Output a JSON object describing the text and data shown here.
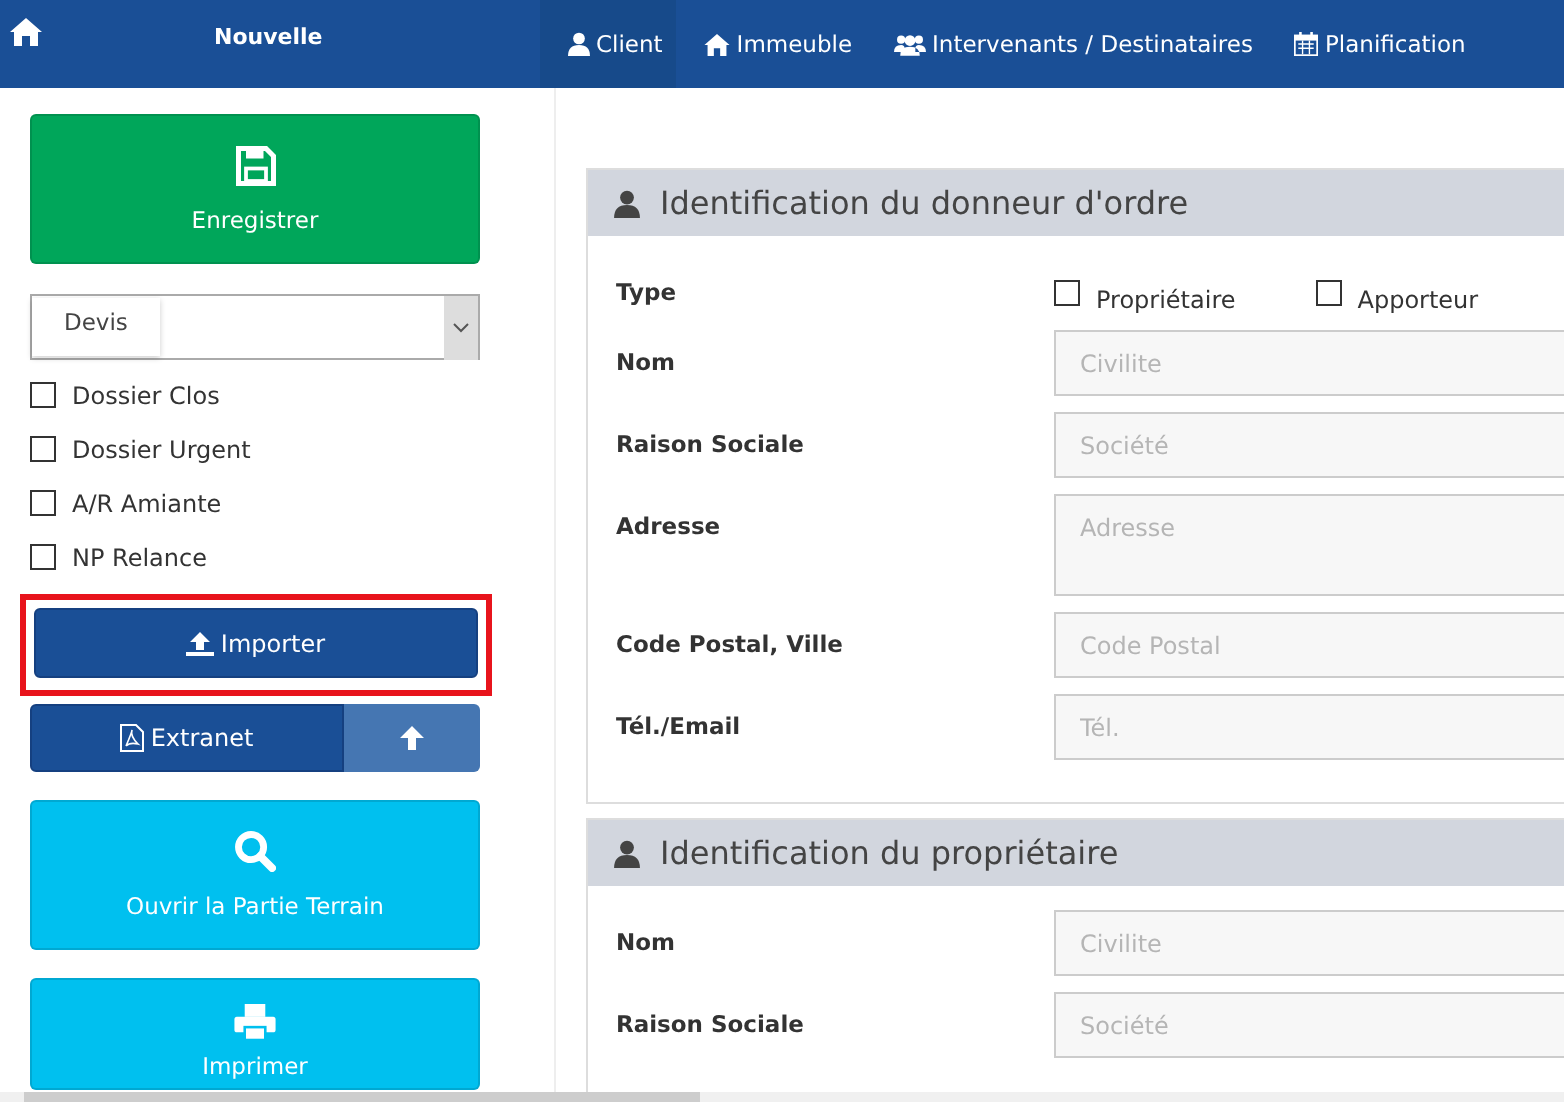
{
  "topbar": {
    "title": "Nouvelle",
    "tabs": [
      {
        "label": "Client",
        "selected": true
      },
      {
        "label": "Immeuble",
        "selected": false
      },
      {
        "label": "Intervenants / Destinataires",
        "selected": false
      },
      {
        "label": "Planification",
        "selected": false
      }
    ]
  },
  "sidebar": {
    "save_button": "Enregistrer",
    "select": {
      "tooltip": "Devis"
    },
    "checkboxes": [
      {
        "label": "Dossier Clos",
        "checked": false
      },
      {
        "label": "Dossier Urgent",
        "checked": false
      },
      {
        "label": "A/R Amiante",
        "checked": false
      },
      {
        "label": "NP Relance",
        "checked": false
      }
    ],
    "import_button": {
      "label": "Importer",
      "highlighted": true
    },
    "extranet_button": "Extranet",
    "open_field_button": "Ouvrir la Partie Terrain",
    "print_button": "Imprimer"
  },
  "panels": [
    {
      "title": "Identification du donneur d'ordre",
      "rows": [
        {
          "kind": "checkboxes",
          "label": "Type",
          "options": [
            {
              "label": "Propriétaire",
              "checked": false
            },
            {
              "label": "Apporteur",
              "checked": false
            }
          ]
        },
        {
          "kind": "input",
          "label": "Nom",
          "placeholder": "Civilite"
        },
        {
          "kind": "input",
          "label": "Raison Sociale",
          "placeholder": "Société"
        },
        {
          "kind": "textarea",
          "label": "Adresse",
          "placeholder": "Adresse"
        },
        {
          "kind": "input",
          "label": "Code Postal, Ville",
          "placeholder": "Code Postal"
        },
        {
          "kind": "input",
          "label": "Tél./Email",
          "placeholder": "Tél."
        }
      ]
    },
    {
      "title": "Identification du propriétaire",
      "rows": [
        {
          "kind": "input",
          "label": "Nom",
          "placeholder": "Civilite"
        },
        {
          "kind": "input",
          "label": "Raison Sociale",
          "placeholder": "Société"
        }
      ]
    }
  ]
}
